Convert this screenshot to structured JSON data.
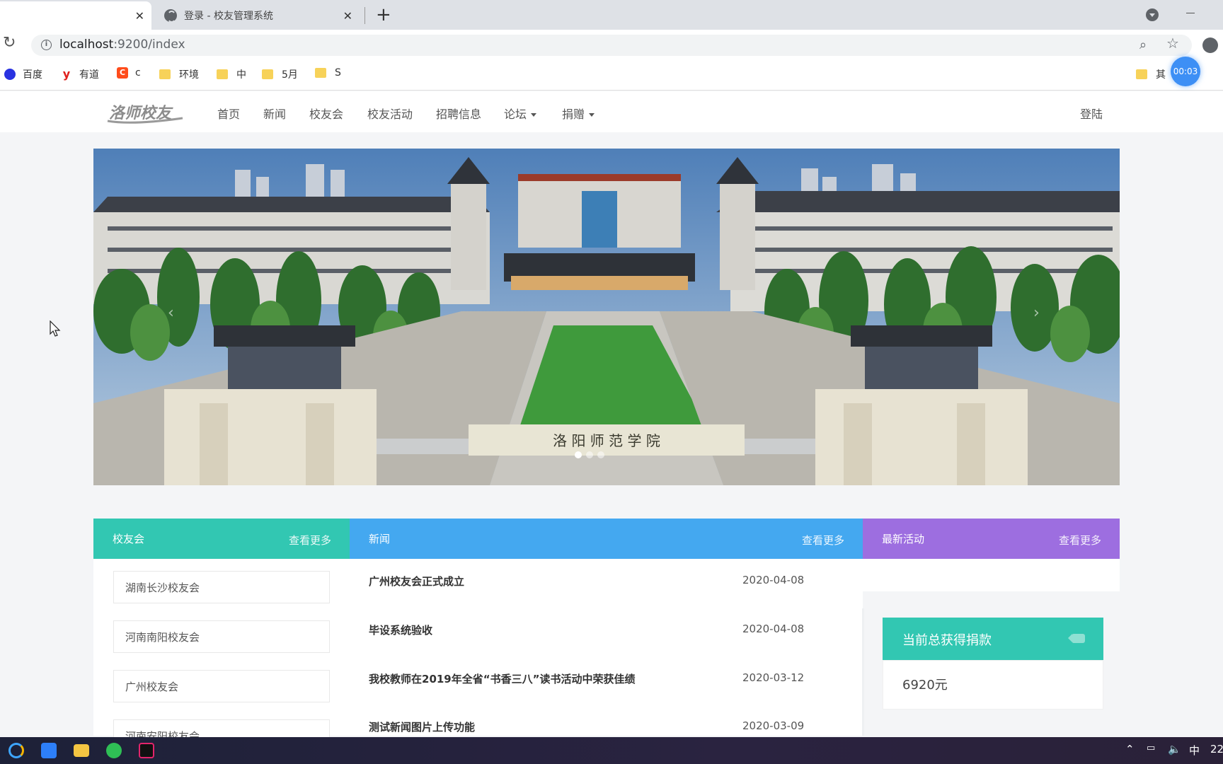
{
  "browser": {
    "tabs": [
      {
        "title": "",
        "active": true
      },
      {
        "title": "登录 - 校友管理系统",
        "active": false
      }
    ],
    "url_host": "localhost",
    "url_path": ":9200/index",
    "bookmarks": [
      {
        "label": "百度",
        "icon": "baidu-icon",
        "color": "#2932e1"
      },
      {
        "label": "有道",
        "icon": "youdao-icon",
        "color": "#e0201c"
      },
      {
        "label": "c",
        "icon": "c-icon",
        "color": "#ff4c1b"
      },
      {
        "label": "环境",
        "icon": "folder-icon"
      },
      {
        "label": "中",
        "icon": "folder-icon"
      },
      {
        "label": "5月",
        "icon": "folder-icon"
      },
      {
        "label": "S",
        "icon": "folder-icon"
      },
      {
        "label": "其",
        "icon": "folder-icon"
      }
    ],
    "timer": "00:03"
  },
  "site": {
    "logo_text": "洛师校友",
    "nav": [
      "首页",
      "新闻",
      "校友会",
      "校友活动",
      "招聘信息",
      "论坛",
      "捐赠"
    ],
    "login": "登陆",
    "banner_caption": "洛 阳 师 范 学 院",
    "sections": {
      "associations": {
        "title": "校友会",
        "more": "查看更多",
        "items": [
          "湖南长沙校友会",
          "河南南阳校友会",
          "广州校友会",
          "河南安阳校友会"
        ]
      },
      "news": {
        "title": "新闻",
        "more": "查看更多",
        "items": [
          {
            "title": "广州校友会正式成立",
            "date": "2020-04-08"
          },
          {
            "title": "毕设系统验收",
            "date": "2020-04-08"
          },
          {
            "title": "我校教师在2019年全省“书香三八”读书活动中荣获佳绩",
            "date": "2020-03-12"
          },
          {
            "title": "测试新闻图片上传功能",
            "date": "2020-03-09"
          }
        ]
      },
      "activities": {
        "title": "最新活动",
        "more": "查看更多"
      }
    },
    "donation": {
      "title": "当前总获得捐款",
      "amount": "6920元"
    }
  },
  "taskbar": {
    "ime": "中",
    "clock": "22"
  }
}
